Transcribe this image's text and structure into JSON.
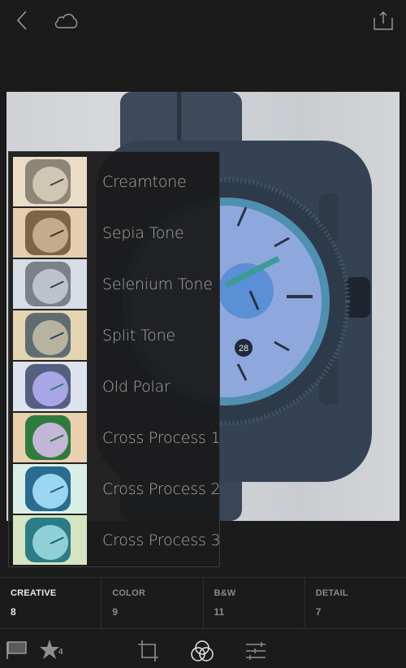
{
  "topbar": {
    "icons": [
      "back-icon",
      "cloud-icon",
      "share-icon"
    ]
  },
  "photo": {
    "subject": "watch",
    "date_window": "28"
  },
  "presets_panel": {
    "items": [
      {
        "label": "Creamtone",
        "bg": "#e9ddc8",
        "tone": "#8d8575",
        "face": "#cfc6b4",
        "hand": "#4a4236"
      },
      {
        "label": "Sepia Tone",
        "bg": "#e6cdb0",
        "tone": "#7d6448",
        "face": "#c4ab8e",
        "hand": "#3f2f22"
      },
      {
        "label": "Selenium Tone",
        "bg": "#d6dde6",
        "tone": "#7c8087",
        "face": "#bcc2ca",
        "hand": "#3b3e44"
      },
      {
        "label": "Split Tone",
        "bg": "#e5d4b2",
        "tone": "#5f6d73",
        "face": "#b7b39f",
        "hand": "#24405a"
      },
      {
        "label": "Old Polar",
        "bg": "#dde2ee",
        "tone": "#55607f",
        "face": "#a9a6e6",
        "hand": "#2a7f76"
      },
      {
        "label": "Cross Process 1",
        "bg": "#ead0ae",
        "tone": "#2f7b3d",
        "face": "#c3b7d8",
        "hand": "#207a45"
      },
      {
        "label": "Cross Process 2",
        "bg": "#d9efe6",
        "tone": "#2a6c91",
        "face": "#9ad6ef",
        "hand": "#1f5c79"
      },
      {
        "label": "Cross Process 3",
        "bg": "#d6e4c2",
        "tone": "#2a7c86",
        "face": "#8fd0d6",
        "hand": "#1f5f6a"
      }
    ]
  },
  "tabs": [
    {
      "name": "CREATIVE",
      "count": "8",
      "active": true
    },
    {
      "name": "COLOR",
      "count": "9",
      "active": false
    },
    {
      "name": "B&W",
      "count": "11",
      "active": false
    },
    {
      "name": "DETAIL",
      "count": "7",
      "active": false
    }
  ],
  "bottombar": {
    "rating_count": "4",
    "icons": [
      "flag-icon",
      "star-icon",
      "crop-icon",
      "presets-icon",
      "adjust-icon"
    ]
  },
  "colors": {
    "background": "#1b1b1b",
    "panel": "#1c1c1d",
    "text_active": "#e8e8e8",
    "text_inactive": "#8a8a8a",
    "watch_accent": "#6f9fd8"
  }
}
